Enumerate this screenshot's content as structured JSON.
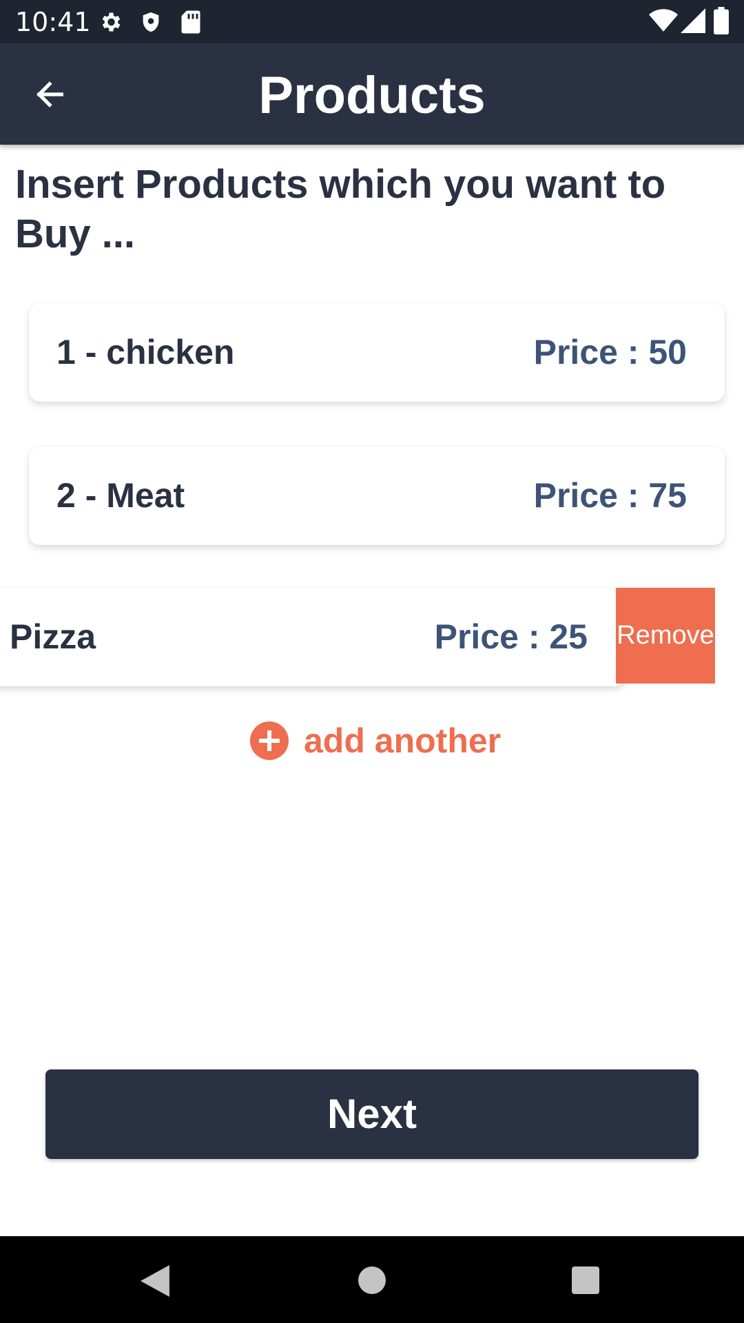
{
  "status_bar": {
    "time": "10:41",
    "left_icons": [
      "gear-icon",
      "shield-icon",
      "sd-card-icon"
    ],
    "right_icons": [
      "wifi-icon",
      "signal-icon",
      "battery-icon"
    ]
  },
  "app_bar": {
    "title": "Products",
    "back_icon": "arrow-left-icon"
  },
  "heading": "Insert Products which you want to Buy ...",
  "products": [
    {
      "name": "1 - chicken",
      "price_label": "Price : 50"
    },
    {
      "name": "2 - Meat",
      "price_label": "Price : 75"
    },
    {
      "name": "Pizza",
      "price_label": "Price : 25",
      "swiped": true,
      "action_label": "Remove"
    }
  ],
  "add_another": {
    "label": "add another",
    "icon": "plus-circle-icon"
  },
  "next_button": {
    "label": "Next"
  },
  "nav_bar": {
    "icons": [
      "back-triangle-icon",
      "home-circle-icon",
      "recents-square-icon"
    ]
  },
  "colors": {
    "primary": "#2a3142",
    "accent": "#ee6e4f",
    "price": "#3d5477",
    "status_bar": "#1f2431"
  }
}
